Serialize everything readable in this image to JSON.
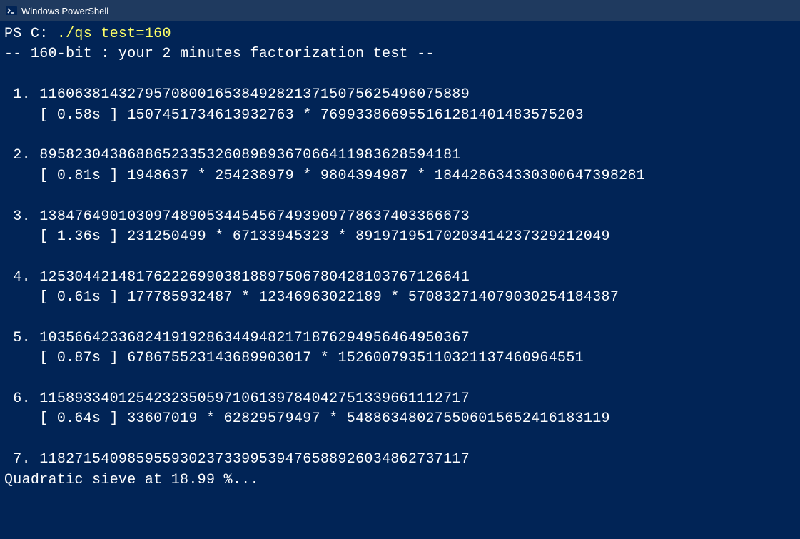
{
  "titlebar": {
    "title": "Windows PowerShell"
  },
  "terminal": {
    "prompt": "PS C: ",
    "command": "./qs",
    "args": " test=160",
    "header": "-- 160-bit : your 2 minutes factorization test --",
    "entries": [
      {
        "idx": " 1.",
        "number": "1160638143279570800165384928213715075625496075889",
        "time": "0.58s",
        "factors": "1507451734613932763 * 769933866955161281401483575203"
      },
      {
        "idx": " 2.",
        "number": "895823043868865233532608989367066411983628594181",
        "time": "0.81s",
        "factors": "1948637 * 254238979 * 9804394987 * 184428634330300647398281"
      },
      {
        "idx": " 3.",
        "number": "1384764901030974890534454567493909778637403366673",
        "time": "1.36s",
        "factors": "231250499 * 67133945323 * 89197195170203414237329212049"
      },
      {
        "idx": " 4.",
        "number": "1253044214817622269903818897506780428103767126641",
        "time": "0.61s",
        "factors": "177785932487 * 12346963022189 * 570832714079030254184387"
      },
      {
        "idx": " 5.",
        "number": "1035664233682419192863449482171876294956464950367",
        "time": "0.87s",
        "factors": "678675523143689903017 * 1526007935110321137460964551"
      },
      {
        "idx": " 6.",
        "number": "1158933401254232350597106139784042751339661112717",
        "time": "0.64s",
        "factors": "33607019 * 62829579497 * 548863480275506015652416183119"
      }
    ],
    "last_entry": {
      "idx": " 7.",
      "number": "1182715409859559302373399539476588926034862737117"
    },
    "progress": "Quadratic sieve at 18.99 %..."
  }
}
